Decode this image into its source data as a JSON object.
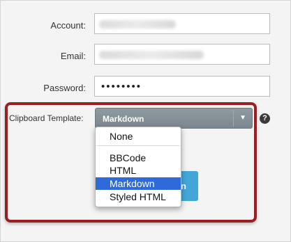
{
  "form": {
    "account_label": "Account:",
    "email_label": "Email:",
    "password_label": "Password:",
    "password_mask": "••••••••",
    "clipboard_label": "Clipboard Template:",
    "help_glyph": "?"
  },
  "template_select": {
    "selected": "Markdown",
    "caret": "▼",
    "options": [
      "None",
      "BBCode",
      "HTML",
      "Markdown",
      "Styled HTML"
    ]
  },
  "behind_button": {
    "partial_text": "n"
  },
  "colors": {
    "highlight_border": "#9a1f23",
    "selected_option": "#2e6ad9",
    "button": "#42a7d6"
  }
}
